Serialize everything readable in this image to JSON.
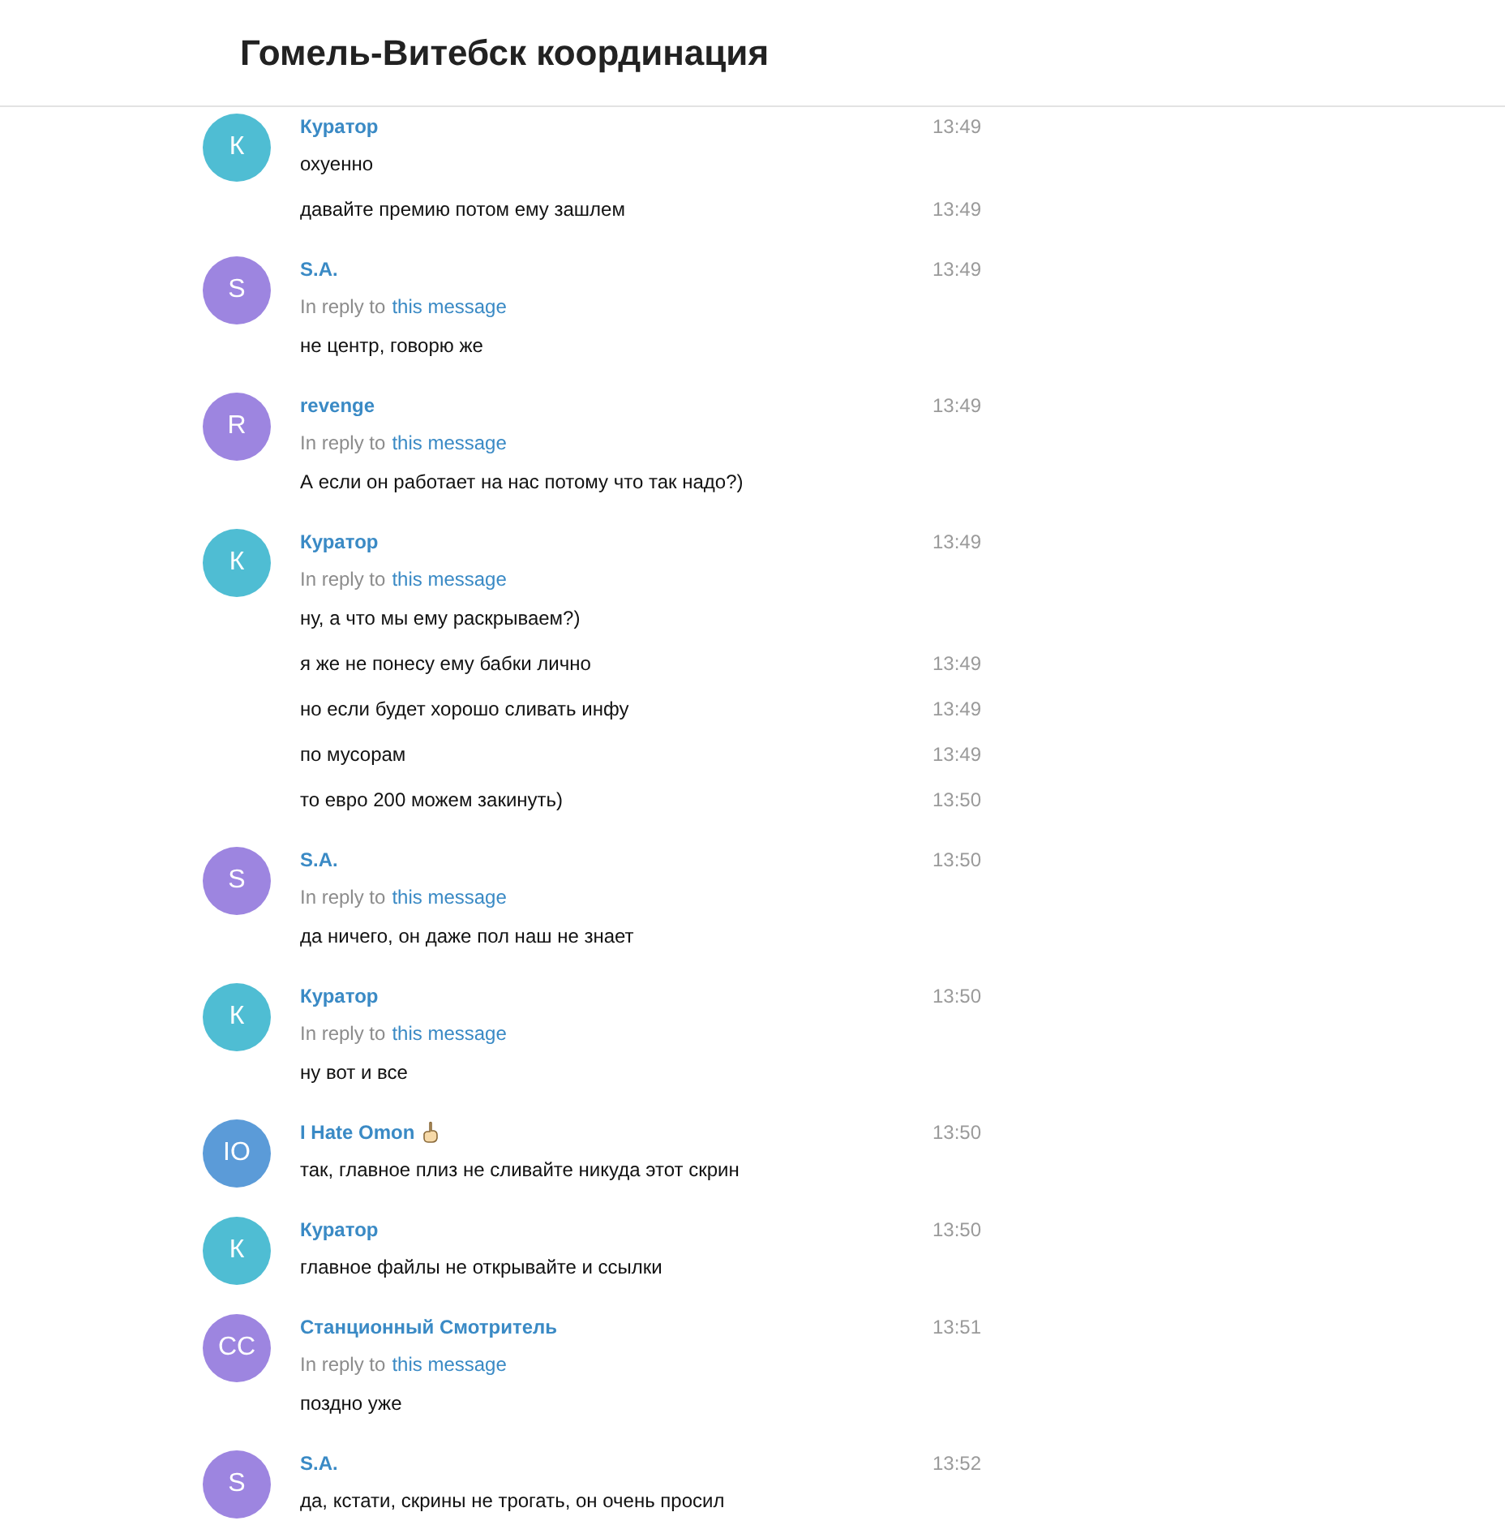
{
  "header": {
    "title": "Гомель-Витебск координация"
  },
  "groups": [
    {
      "initials": "К",
      "color": "#4fbdd3",
      "name": "Куратор",
      "time": "13:49",
      "messages": [
        {
          "text": "охуенно"
        },
        {
          "text": "давайте премию потом ему зашлем",
          "time": "13:49"
        }
      ]
    },
    {
      "initials": "S",
      "color": "#9d85e0",
      "name": "S.A.",
      "time": "13:49",
      "reply": {
        "prefix": "In reply to",
        "link": "this message"
      },
      "messages": [
        {
          "text": "не центр, говорю же"
        }
      ]
    },
    {
      "initials": "R",
      "color": "#9d85e0",
      "name": "revenge",
      "time": "13:49",
      "reply": {
        "prefix": "In reply to",
        "link": "this message"
      },
      "messages": [
        {
          "text": "А если он работает на нас потому что так надо?)"
        }
      ]
    },
    {
      "initials": "К",
      "color": "#4fbdd3",
      "name": "Куратор",
      "time": "13:49",
      "reply": {
        "prefix": "In reply to",
        "link": "this message"
      },
      "messages": [
        {
          "text": "ну, а что мы ему раскрываем?)"
        },
        {
          "text": "я же не понесу ему бабки лично",
          "time": "13:49"
        },
        {
          "text": "но если будет хорошо сливать инфу",
          "time": "13:49"
        },
        {
          "text": "по мусорам",
          "time": "13:49"
        },
        {
          "text": "то евро 200 можем закинуть)",
          "time": "13:50"
        }
      ]
    },
    {
      "initials": "S",
      "color": "#9d85e0",
      "name": "S.A.",
      "time": "13:50",
      "reply": {
        "prefix": "In reply to",
        "link": "this message"
      },
      "messages": [
        {
          "text": "да ничего, он даже пол наш не знает"
        }
      ]
    },
    {
      "initials": "К",
      "color": "#4fbdd3",
      "name": "Куратор",
      "time": "13:50",
      "reply": {
        "prefix": "In reply to",
        "link": "this message"
      },
      "messages": [
        {
          "text": "ну вот и все"
        }
      ]
    },
    {
      "initials": "IO",
      "color": "#5b9bd8",
      "name": "I Hate Omon",
      "hand_icon": true,
      "time": "13:50",
      "messages": [
        {
          "text": "так, главное плиз не сливайте никуда этот скрин"
        }
      ]
    },
    {
      "initials": "К",
      "color": "#4fbdd3",
      "name": "Куратор",
      "time": "13:50",
      "messages": [
        {
          "text": "главное файлы не открывайте и ссылки"
        }
      ]
    },
    {
      "initials": "СС",
      "color": "#9d85e0",
      "name": "Станционный Смотритель",
      "time": "13:51",
      "reply": {
        "prefix": "In reply to",
        "link": "this message"
      },
      "messages": [
        {
          "text": "поздно уже"
        }
      ]
    },
    {
      "initials": "S",
      "color": "#9d85e0",
      "name": "S.A.",
      "time": "13:52",
      "messages": [
        {
          "text": "да, кстати, скрины не трогать, он очень просил"
        }
      ]
    }
  ]
}
